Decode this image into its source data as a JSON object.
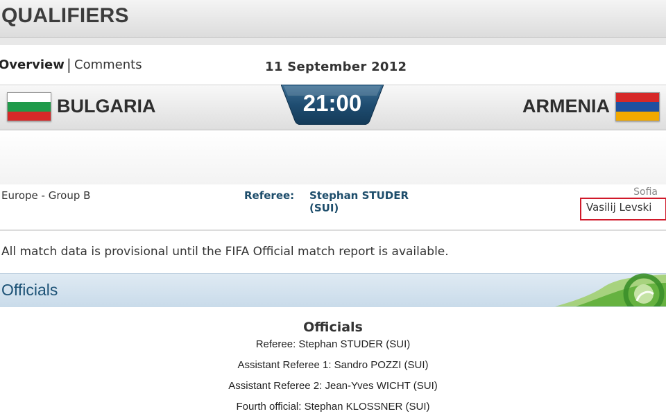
{
  "header": {
    "title": "QUALIFIERS"
  },
  "tabs": [
    {
      "label": "Overview",
      "active": true
    },
    {
      "label": "Comments",
      "active": false
    }
  ],
  "tab_separator": "|",
  "match": {
    "date": "11 September 2012",
    "home_team": "BULGARIA",
    "away_team": "ARMENIA",
    "kickoff": "21:00",
    "group": "Europe - Group B",
    "referee_label": "Referee:",
    "referee_name": "Stephan STUDER (SUI)",
    "city": "Sofia",
    "stadium": "Vasilij Levski",
    "home_flag_colors": [
      "#ffffff",
      "#1f9a4a",
      "#d62828"
    ],
    "away_flag_colors": [
      "#d62828",
      "#1e50a0",
      "#f2a900"
    ]
  },
  "notice": "All match data is provisional until the FIFA Official match report is available.",
  "officials_section": {
    "title": "Officials",
    "heading": "Officials",
    "lines": [
      "Referee: Stephan STUDER (SUI)",
      "Assistant Referee 1: Sandro POZZI (SUI)",
      "Assistant Referee 2: Jean-Yves WICHT (SUI)",
      "Fourth official: Stephan KLOSSNER (SUI)"
    ]
  },
  "colors": {
    "highlight_box": "#d0192a",
    "badge": "#1c4a6e",
    "section_title": "#1c5276"
  }
}
